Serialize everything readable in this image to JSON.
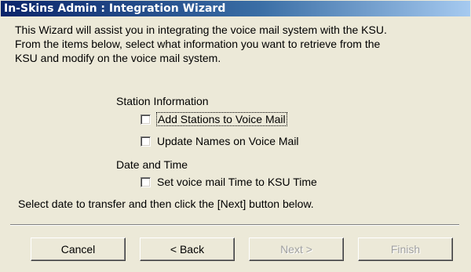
{
  "window": {
    "title": "In-Skins Admin : Integration Wizard"
  },
  "intro": {
    "line1": "This Wizard will assist you in integrating the voice mail system with the KSU.",
    "line2": "From the items below, select what information you want to retrieve from the",
    "line3": "KSU and modify on the voice mail system."
  },
  "station_section": {
    "heading": "Station Information",
    "options": [
      {
        "label": "Add Stations to Voice Mail",
        "checked": false
      },
      {
        "label": "Update Names on Voice Mail",
        "checked": false
      }
    ]
  },
  "date_section": {
    "heading": "Date and Time",
    "options": [
      {
        "label": "Set voice mail Time to KSU Time",
        "checked": false
      }
    ]
  },
  "instruction": "Select date to transfer and then click the [Next] button below.",
  "buttons": {
    "cancel": "Cancel",
    "back": "< Back",
    "next": "Next >",
    "finish": "Finish"
  }
}
